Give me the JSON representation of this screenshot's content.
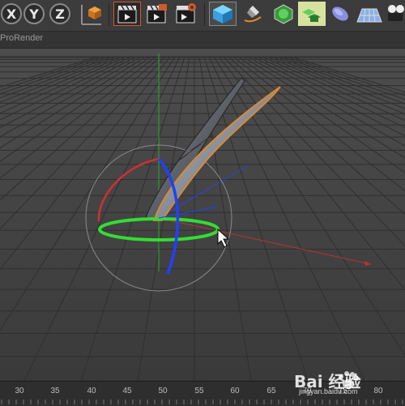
{
  "toolbar": {
    "axis_x": "X",
    "axis_y": "Y",
    "axis_z": "Z",
    "icons": [
      "coordinate-cube-icon",
      "render-view-icon",
      "render-picture-viewer-icon",
      "render-settings-icon",
      "cube-primitive-icon",
      "pen-spline-icon",
      "subdivision-icon",
      "array-icon",
      "deformer-icon",
      "floor-plane-icon",
      "camera-icon"
    ]
  },
  "viewport": {
    "title": "ProRender"
  },
  "timeline": {
    "ticks": [
      "30",
      "35",
      "40",
      "45",
      "50",
      "55",
      "60",
      "65",
      "70",
      "75",
      "80"
    ]
  },
  "watermark": {
    "text": "Bai 经验",
    "url": "jingyan.baidu.com"
  },
  "colors": {
    "x_axis": "#d03030",
    "y_axis": "#33cc33",
    "z_axis": "#2040ff",
    "selection": "#e08a2a"
  }
}
